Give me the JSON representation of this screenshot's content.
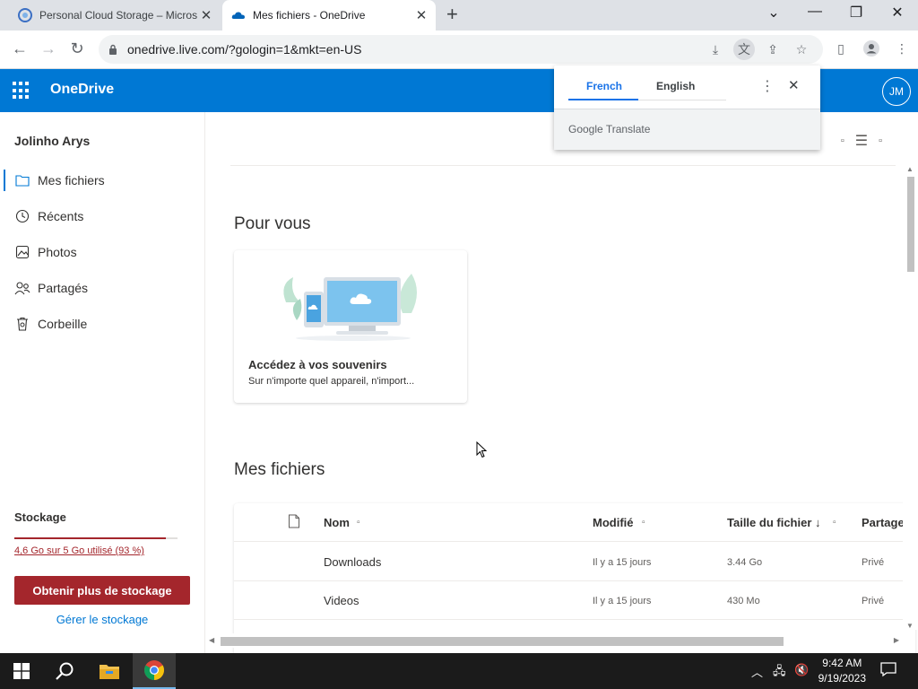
{
  "browser": {
    "tabs": [
      {
        "title": "Personal Cloud Storage – Microsoft",
        "active": false
      },
      {
        "title": "Mes fichiers - OneDrive",
        "active": true
      }
    ],
    "url": "onedrive.live.com/?gologin=1&mkt=en-US",
    "new_tab": "+"
  },
  "translate": {
    "source_lang": "French",
    "target_lang": "English",
    "brand": "Google Translate"
  },
  "header": {
    "brand": "OneDrive",
    "avatar_initials": "JM",
    "color": "#0078d4"
  },
  "sidebar": {
    "user": "Jolinho Arys",
    "items": [
      {
        "label": "Mes fichiers",
        "icon": "folder-icon",
        "selected": true
      },
      {
        "label": "Récents",
        "icon": "history-icon"
      },
      {
        "label": "Photos",
        "icon": "photo-icon"
      },
      {
        "label": "Partagés",
        "icon": "people-icon"
      },
      {
        "label": "Corbeille",
        "icon": "trash-icon"
      }
    ],
    "storage": {
      "title": "Stockage",
      "usage": "4,6 Go sur 5 Go utilisé (93 %)",
      "fraction": 0.93,
      "upgrade_button": "Obtenir plus de stockage",
      "manage_link": "Gérer le stockage",
      "color": "#a4262c"
    }
  },
  "main": {
    "for_you_title": "Pour vous",
    "card": {
      "title": "Accédez à vos souvenirs",
      "subtitle": "Sur n'importe quel appareil, n'import..."
    },
    "files_title": "Mes fichiers",
    "columns": {
      "name": "Nom",
      "modified": "Modifié",
      "size": "Taille du fichier ↓",
      "sharing": "Partage"
    },
    "rows": [
      {
        "name": "Downloads",
        "modified": "Il y a 15 jours",
        "size": "3.44 Go",
        "sharing": "Privé"
      },
      {
        "name": "Videos",
        "modified": "Il y a 15 jours",
        "size": "430 Mo",
        "sharing": "Privé"
      }
    ]
  },
  "taskbar": {
    "time": "9:42 AM",
    "date": "9/19/2023"
  }
}
